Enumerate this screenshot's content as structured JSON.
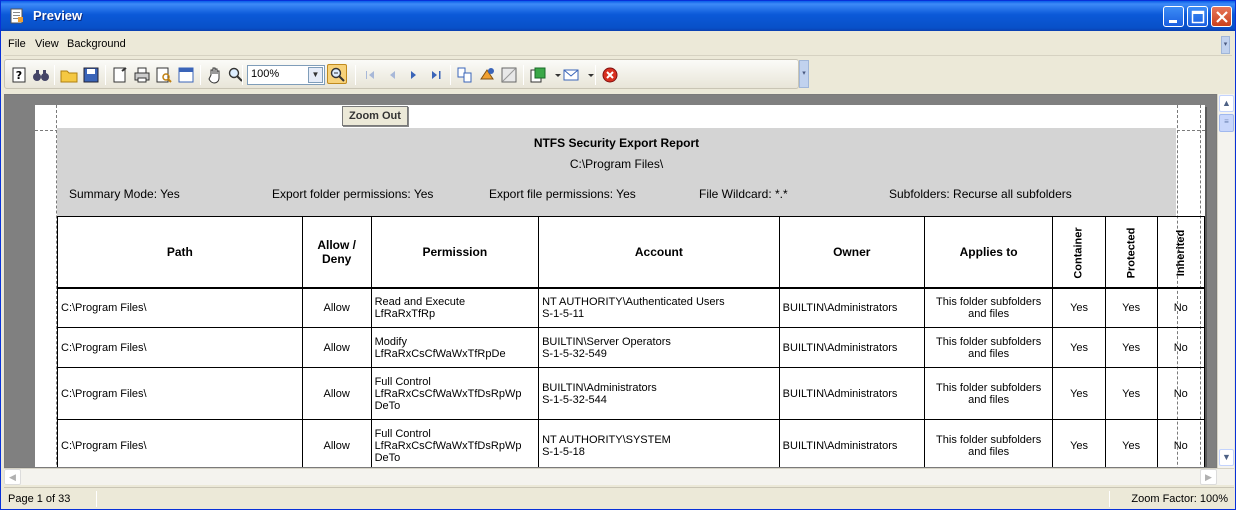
{
  "window": {
    "title": "Preview"
  },
  "menu": {
    "items": [
      "File",
      "View",
      "Background"
    ]
  },
  "toolbar": {
    "zoom_value": "100%",
    "tooltip": "Zoom Out",
    "icons": [
      "help-icon",
      "find-icon",
      "open-icon",
      "save-icon",
      "page-setup-icon",
      "print-icon",
      "print-preview-icon",
      "export-icon",
      "hand-icon",
      "magnifier-icon",
      "zoom-out-icon",
      "zoom-in-icon",
      "first-page-icon",
      "previous-page-icon",
      "next-page-icon",
      "last-page-icon",
      "multiple-pages-icon",
      "color-icon",
      "watermark-icon",
      "export-document-icon",
      "email-icon",
      "close-preview-icon"
    ]
  },
  "report": {
    "title": "NTFS Security Export Report",
    "path": "C:\\Program Files\\",
    "summary": {
      "mode": "Summary Mode: Yes",
      "folder_perms": "Export folder permissions: Yes",
      "file_perms": "Export file permissions: Yes",
      "wildcard": "File Wildcard: *.*",
      "subfolders": "Subfolders: Recurse all subfolders"
    },
    "columns": [
      "Path",
      "Allow / Deny",
      "Permission",
      "Account",
      "Owner",
      "Applies to",
      "Container",
      "Protected",
      "Inherited"
    ],
    "rows": [
      {
        "path": "C:\\Program Files\\",
        "allow": "Allow",
        "perm1": "Read and Execute",
        "perm2": "LfRaRxTfRp",
        "perm3": "",
        "acct1": "NT AUTHORITY\\Authenticated Users",
        "acct2": "S-1-5-11",
        "owner": "BUILTIN\\Administrators",
        "applies": "This folder subfolders and files",
        "container": "Yes",
        "protected": "Yes",
        "inherited": "No"
      },
      {
        "path": "C:\\Program Files\\",
        "allow": "Allow",
        "perm1": "Modify",
        "perm2": "LfRaRxCsCfWaWxTfRpDe",
        "perm3": "",
        "acct1": "BUILTIN\\Server Operators",
        "acct2": "S-1-5-32-549",
        "owner": "BUILTIN\\Administrators",
        "applies": "This folder subfolders and files",
        "container": "Yes",
        "protected": "Yes",
        "inherited": "No"
      },
      {
        "path": "C:\\Program Files\\",
        "allow": "Allow",
        "perm1": "Full Control",
        "perm2": "LfRaRxCsCfWaWxTfDsRpWp",
        "perm3": "DeTo",
        "acct1": "BUILTIN\\Administrators",
        "acct2": "S-1-5-32-544",
        "owner": "BUILTIN\\Administrators",
        "applies": "This folder subfolders and files",
        "container": "Yes",
        "protected": "Yes",
        "inherited": "No"
      },
      {
        "path": "C:\\Program Files\\",
        "allow": "Allow",
        "perm1": "Full Control",
        "perm2": "LfRaRxCsCfWaWxTfDsRpWp",
        "perm3": "DeTo",
        "acct1": "NT AUTHORITY\\SYSTEM",
        "acct2": "S-1-5-18",
        "owner": "BUILTIN\\Administrators",
        "applies": "This folder subfolders and files",
        "container": "Yes",
        "protected": "Yes",
        "inherited": "No"
      }
    ]
  },
  "status": {
    "page": "Page 1 of 33",
    "zoom": "Zoom Factor: 100%"
  }
}
